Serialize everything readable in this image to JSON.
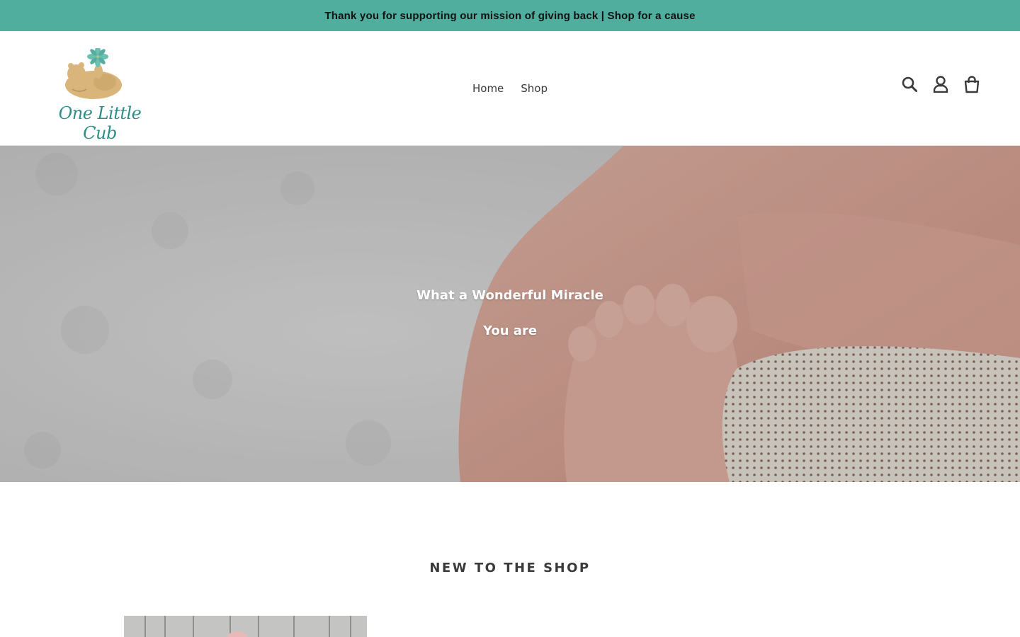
{
  "announcement": {
    "text": "Thank you for supporting our mission of giving back | Shop for a cause"
  },
  "header": {
    "logo_text": "One Little Cub",
    "nav": [
      {
        "label": "Home"
      },
      {
        "label": "Shop"
      }
    ],
    "icons": [
      "search-icon",
      "account-icon",
      "cart-icon"
    ]
  },
  "hero": {
    "line1": "What a Wonderful Miracle",
    "line2": "You are"
  },
  "featured": {
    "title": "NEW TO THE SHOP"
  },
  "colors": {
    "announcement_bg": "#50ae9f",
    "brand_teal": "#2e8e87",
    "text": "#3a3a3a"
  }
}
